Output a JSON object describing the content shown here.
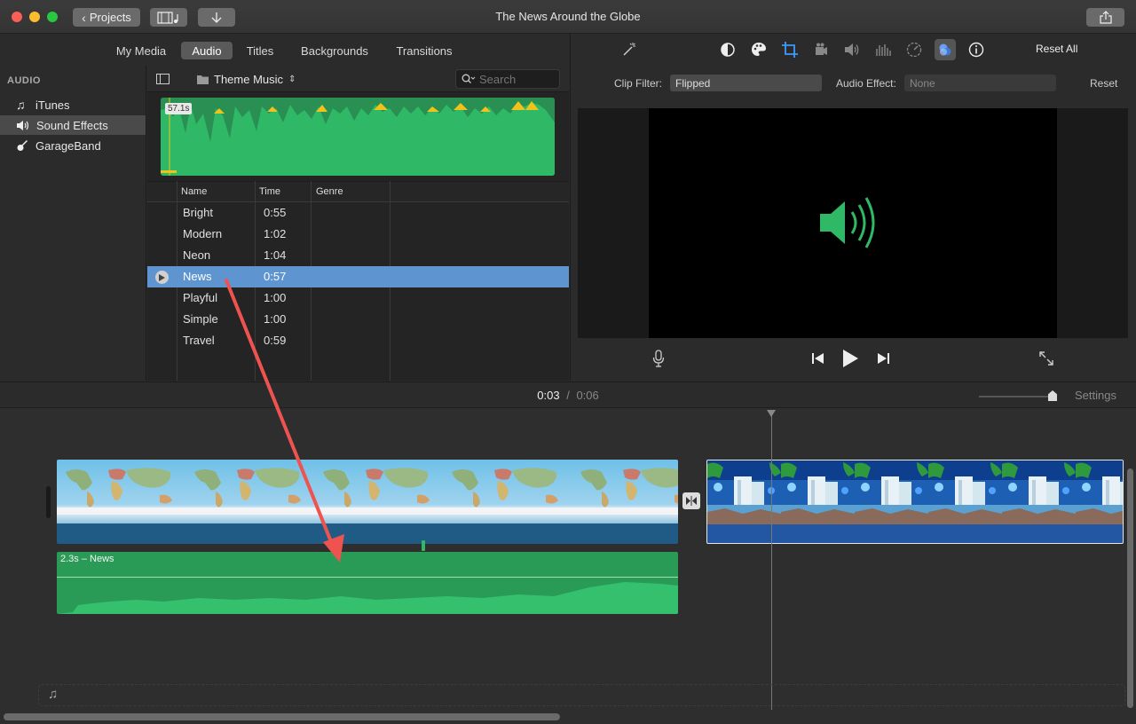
{
  "window": {
    "title": "The News Around the Globe",
    "projects_label": "Projects"
  },
  "browser": {
    "tabs": [
      "My Media",
      "Audio",
      "Titles",
      "Backgrounds",
      "Transitions"
    ],
    "active_tab": "Audio"
  },
  "sidebar": {
    "heading": "AUDIO",
    "items": [
      {
        "label": "iTunes",
        "icon": "music-note-icon"
      },
      {
        "label": "Sound Effects",
        "icon": "speaker-icon"
      },
      {
        "label": "GarageBand",
        "icon": "guitar-icon"
      }
    ],
    "selected": "Sound Effects"
  },
  "library": {
    "folder": "Theme Music",
    "search_placeholder": "Search",
    "preview_duration": "57.1s",
    "columns": [
      "Name",
      "Time",
      "Genre"
    ],
    "rows": [
      {
        "name": "Bright",
        "time": "0:55",
        "genre": ""
      },
      {
        "name": "Modern",
        "time": "1:02",
        "genre": ""
      },
      {
        "name": "Neon",
        "time": "1:04",
        "genre": ""
      },
      {
        "name": "News",
        "time": "0:57",
        "genre": ""
      },
      {
        "name": "Playful",
        "time": "1:00",
        "genre": ""
      },
      {
        "name": "Simple",
        "time": "1:00",
        "genre": ""
      },
      {
        "name": "Travel",
        "time": "0:59",
        "genre": ""
      }
    ],
    "selected_row": "News"
  },
  "inspector": {
    "reset_all": "Reset All",
    "clip_filter_label": "Clip Filter:",
    "clip_filter_value": "Flipped",
    "audio_effect_label": "Audio Effect:",
    "audio_effect_value": "None",
    "reset": "Reset"
  },
  "timeline": {
    "current_time": "0:03",
    "separator": "/",
    "total_time": "0:06",
    "settings": "Settings",
    "audio_clip_label": "2.3s – News"
  },
  "colors": {
    "audio_green": "#2fb865",
    "selection_blue": "#5e95d1",
    "annotation_red": "#ef5350"
  }
}
